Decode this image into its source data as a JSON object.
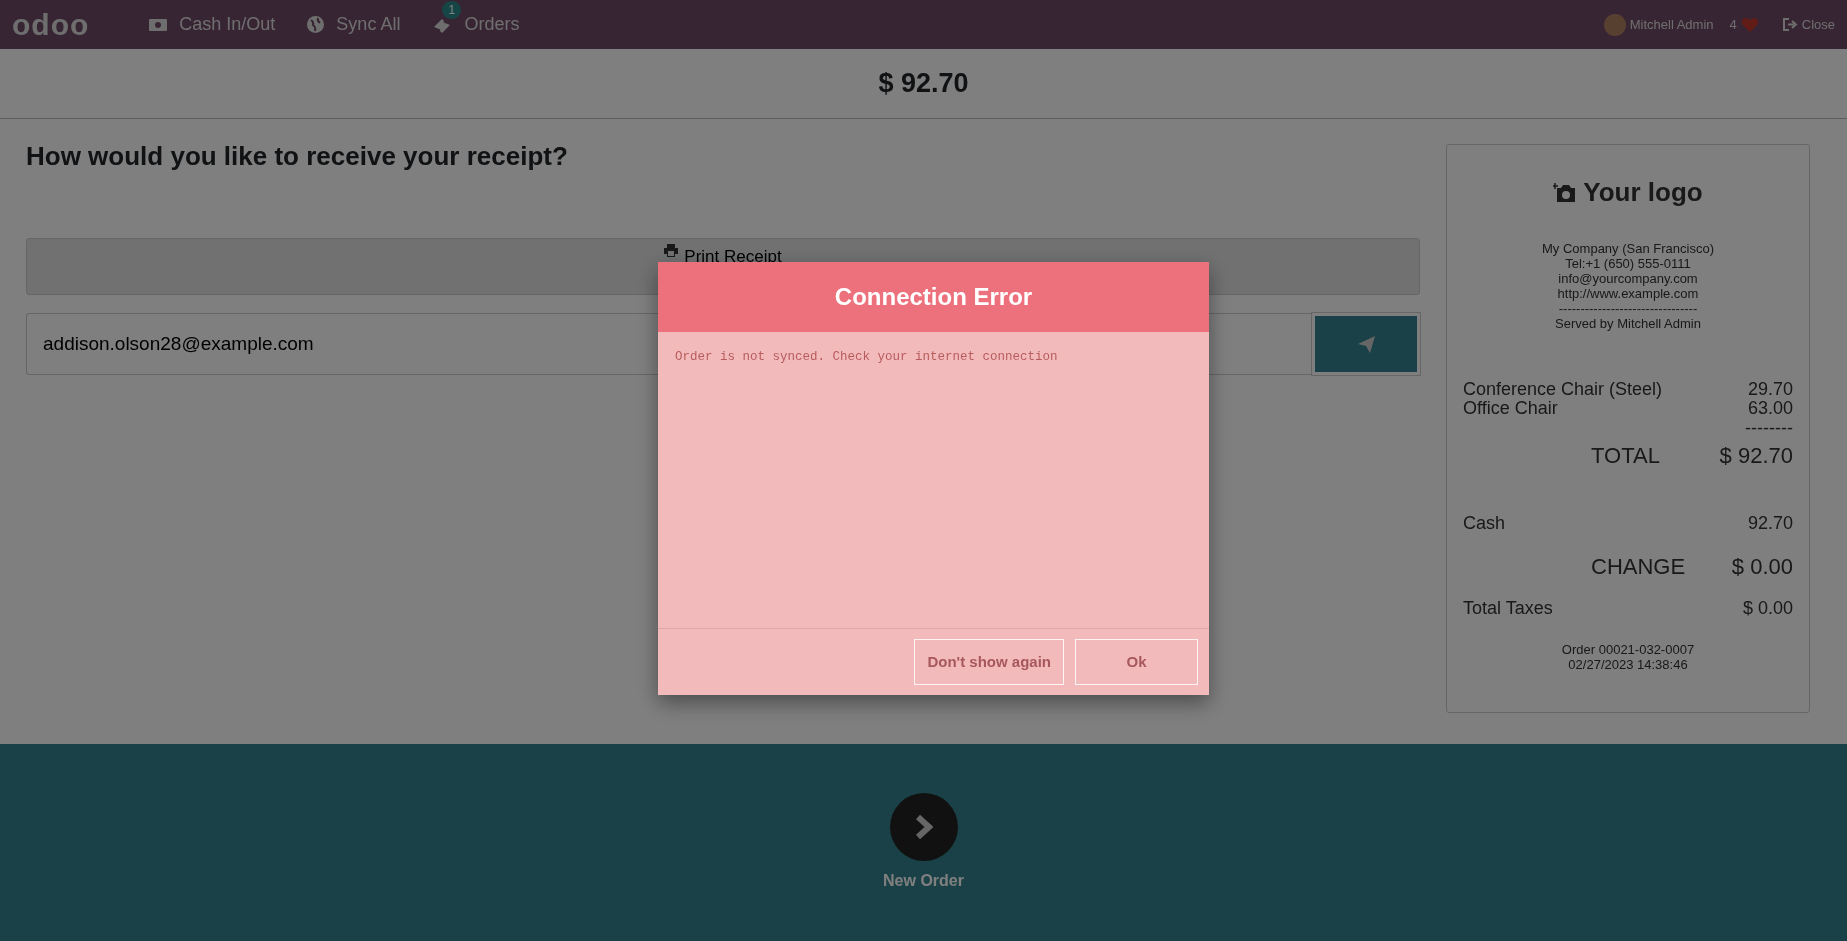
{
  "navbar": {
    "logo": "odoo",
    "items": [
      {
        "label": "Cash In/Out"
      },
      {
        "label": "Sync All"
      },
      {
        "label": "Orders",
        "badge": "1"
      }
    ],
    "user": "Mitchell Admin",
    "counter": "4",
    "close": "Close"
  },
  "amount": "$ 92.70",
  "receipt_options": {
    "heading": "How would you like to receive your receipt?",
    "print_button": "Print Receipt",
    "email": {
      "value": "addison.olson28@example.com"
    }
  },
  "receipt": {
    "logo_text": "Your logo",
    "header_lines": [
      "My Company (San Francisco)",
      "Tel:+1 (650) 555-0111",
      "info@yourcompany.com",
      "http://www.example.com"
    ],
    "separator": "--------------------------------",
    "served_by": "Served by Mitchell Admin",
    "lines": [
      {
        "name": "Conference Chair (Steel)",
        "price": "29.70"
      },
      {
        "name": "Office Chair",
        "price": "63.00"
      }
    ],
    "subtotal_rule": "--------",
    "total": {
      "label": "TOTAL",
      "value": "$ 92.70"
    },
    "payments": [
      {
        "name": "Cash",
        "amount": "92.70"
      }
    ],
    "change": {
      "label": "CHANGE",
      "value": "$ 0.00"
    },
    "taxes": {
      "label": "Total Taxes",
      "value": "$ 0.00"
    },
    "footer_lines": [
      "Order 00021-032-0007",
      "02/27/2023 14:38:46"
    ]
  },
  "footer": {
    "new_order": "New Order"
  },
  "dialog": {
    "title": "Connection Error",
    "message": "Order is not synced. Check your internet connection",
    "buttons": [
      "Don't show again",
      "Ok"
    ]
  }
}
